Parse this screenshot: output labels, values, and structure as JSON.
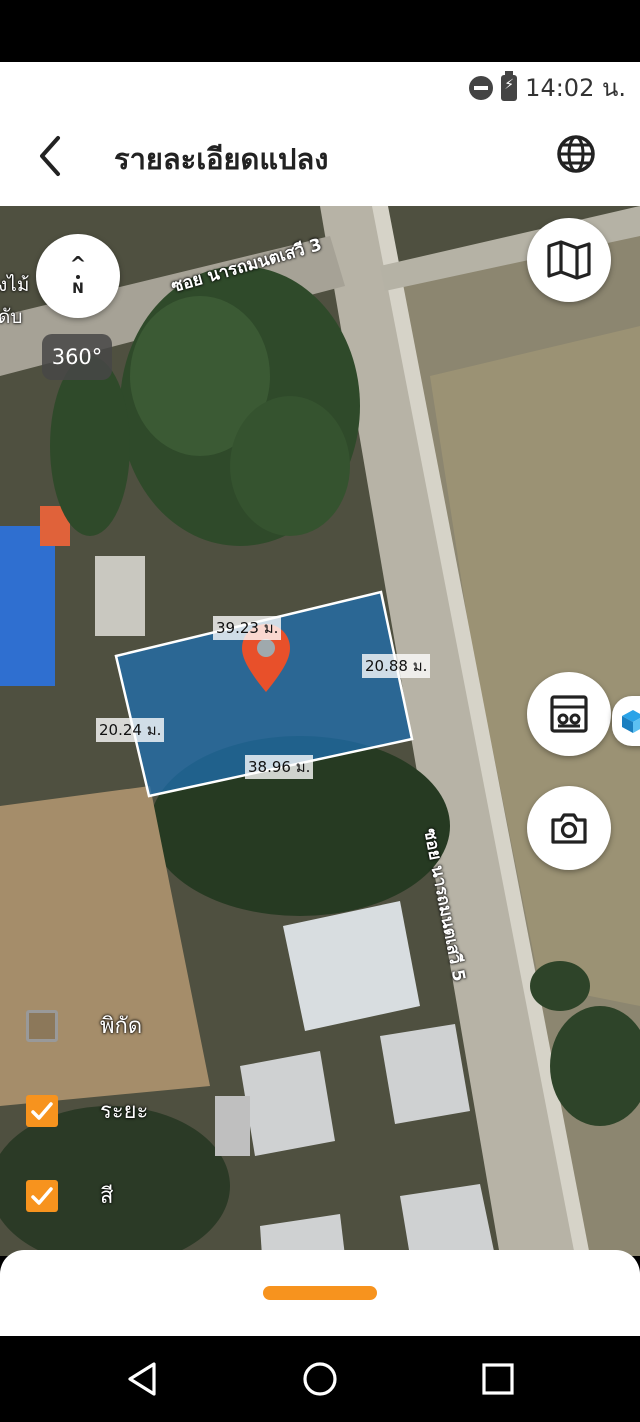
{
  "status_bar": {
    "time": "14:02 น.",
    "icons": [
      "do-not-disturb-icon",
      "battery-charging-icon"
    ]
  },
  "app_bar": {
    "title": "รายละเอียดแปลง",
    "left_icon": "back-arrow-icon",
    "right_icon": "globe-icon"
  },
  "map": {
    "compass_label": "N",
    "badge_360": "360°",
    "road_labels": {
      "top_street": "ซอย นารถมนตเสวี 3",
      "side_street": "ซอย นารถมนตเสวี 5"
    },
    "edge_labels": [
      "งไม้",
      "ดับ"
    ],
    "plot": {
      "top_edge": "39.23 ม.",
      "right_edge": "20.88 ม.",
      "left_edge": "20.24 ม.",
      "bottom_edge": "38.96 ม."
    },
    "right_buttons": [
      "map-layers-icon",
      "calculator-icon",
      "camera-icon"
    ],
    "toggles": [
      {
        "label": "พิกัด",
        "checked": false
      },
      {
        "label": "ระยะ",
        "checked": true
      },
      {
        "label": "สี",
        "checked": true
      }
    ]
  },
  "colors": {
    "accent": "#f7931e",
    "pin": "#e8502a",
    "plot_fill": "#1f6fb0"
  },
  "nav_bar": {
    "icons": [
      "back-triangle-icon",
      "home-circle-icon",
      "recents-square-icon"
    ]
  }
}
